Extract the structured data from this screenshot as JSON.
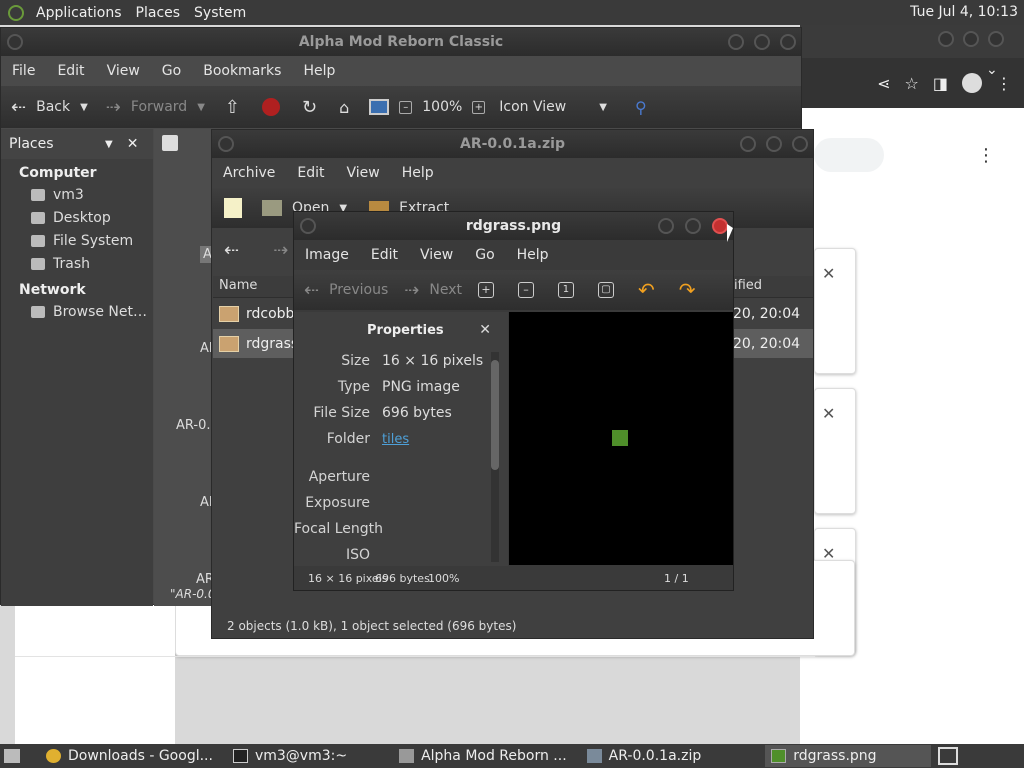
{
  "topbar": {
    "menus": [
      "Applications",
      "Places",
      "System"
    ],
    "clock": "Tue Jul 4, 10:13"
  },
  "nautilus": {
    "title": "Alpha Mod Reborn Classic",
    "menus": [
      "File",
      "Edit",
      "View",
      "Go",
      "Bookmarks",
      "Help"
    ],
    "toolbar": {
      "back": "Back",
      "forward": "Forward",
      "zoom": "100%",
      "view": "Icon View"
    },
    "sidebar": {
      "header": "Places",
      "sections": [
        {
          "title": "Computer",
          "items": [
            "vm3",
            "Desktop",
            "File System",
            "Trash"
          ]
        },
        {
          "title": "Network",
          "items": [
            "Browse Net…"
          ]
        }
      ]
    },
    "items": [
      "Al",
      "Al",
      "AR-0.0",
      "AR",
      "AR"
    ],
    "status": "\"AR-0.0"
  },
  "archive": {
    "title": "AR-0.0.1a.zip",
    "menus": [
      "Archive",
      "Edit",
      "View",
      "Help"
    ],
    "toolbar": {
      "open": "Open",
      "extract": "Extract"
    },
    "columns": {
      "name": "Name",
      "modified": "ified"
    },
    "rows": [
      {
        "name": "rdcobbl",
        "date": "20, 20:04"
      },
      {
        "name": "rdgrass",
        "date": "20, 20:04"
      }
    ],
    "status": "2 objects (1.0 kB), 1 object selected (696 bytes)"
  },
  "eog": {
    "title": "rdgrass.png",
    "menus": [
      "Image",
      "Edit",
      "View",
      "Go",
      "Help"
    ],
    "toolbar": {
      "previous": "Previous",
      "next": "Next"
    },
    "props_title": "Properties",
    "props": [
      {
        "k": "Size",
        "v": "16 × 16 pixels"
      },
      {
        "k": "Type",
        "v": "PNG image"
      },
      {
        "k": "File Size",
        "v": "696 bytes"
      }
    ],
    "folder_key": "Folder",
    "folder_val": "tiles",
    "props2": [
      "Aperture",
      "Exposure",
      "Focal Length",
      "ISO"
    ],
    "status": {
      "dims": "16 × 16 pixels",
      "size": "696 bytes",
      "zoom": "100%",
      "page": "1 / 1"
    }
  },
  "taskbar": [
    "Downloads - Googl...",
    "vm3@vm3:~",
    "Alpha Mod Reborn ...",
    "AR-0.0.1a.zip",
    "rdgrass.png"
  ],
  "colors": {
    "accent": "#4ea0d8",
    "close_red": "#c43030",
    "grass": "#4f8f2a"
  }
}
